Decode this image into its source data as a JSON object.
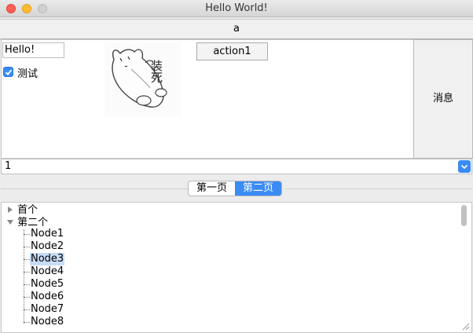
{
  "window": {
    "title": "Hello World!"
  },
  "top_button": {
    "label": "a"
  },
  "line_edit": {
    "value": "Hello!"
  },
  "checkbox": {
    "label": "测试",
    "checked": true
  },
  "action_button": {
    "label": "action1"
  },
  "image": {
    "text": "装死"
  },
  "message_button": {
    "label": "消息"
  },
  "combo": {
    "value": "1"
  },
  "tabs": [
    {
      "label": "第一页",
      "active": false
    },
    {
      "label": "第二页",
      "active": true
    }
  ],
  "tree": {
    "items": [
      {
        "label": "首个",
        "expanded": false
      },
      {
        "label": "第二个",
        "expanded": true
      }
    ],
    "children": [
      "Node1",
      "Node2",
      "Node3",
      "Node4",
      "Node5",
      "Node6",
      "Node7",
      "Node8"
    ],
    "selected": "Node3"
  },
  "colors": {
    "accent": "#3b8bf5",
    "selection": "#c7dcf6"
  }
}
